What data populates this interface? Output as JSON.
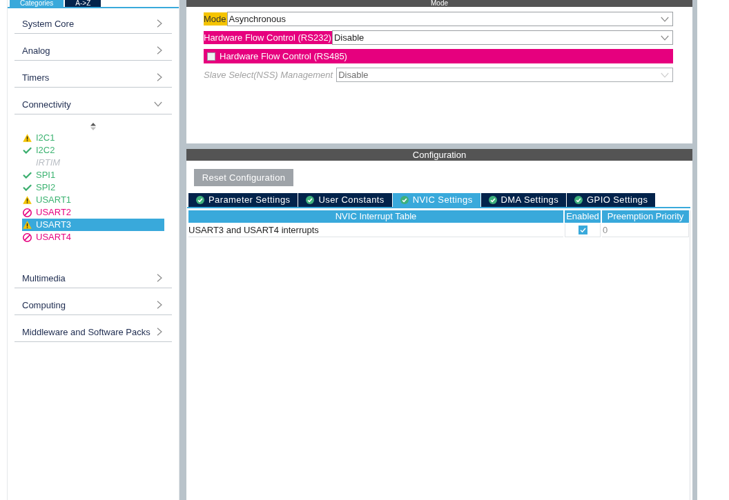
{
  "sidebar": {
    "tabs": [
      {
        "label": "Categories",
        "selected": true
      },
      {
        "label": "A->Z",
        "selected": false
      }
    ],
    "categories": [
      {
        "label": "System Core",
        "expanded": false
      },
      {
        "label": "Analog",
        "expanded": false
      },
      {
        "label": "Timers",
        "expanded": false
      },
      {
        "label": "Connectivity",
        "expanded": true,
        "children": [
          {
            "label": "I2C1",
            "kind": "warning",
            "selected": false
          },
          {
            "label": "I2C2",
            "kind": "ok",
            "selected": false
          },
          {
            "label": "IRTIM",
            "kind": "disabled",
            "selected": false
          },
          {
            "label": "SPI1",
            "kind": "ok",
            "selected": false
          },
          {
            "label": "SPI2",
            "kind": "ok",
            "selected": false
          },
          {
            "label": "USART1",
            "kind": "warning",
            "selected": false
          },
          {
            "label": "USART2",
            "kind": "error",
            "selected": false
          },
          {
            "label": "USART3",
            "kind": "warning",
            "selected": true
          },
          {
            "label": "USART4",
            "kind": "error",
            "selected": false
          }
        ]
      },
      {
        "label": "Multimedia",
        "expanded": false
      },
      {
        "label": "Computing",
        "expanded": false
      },
      {
        "label": "Middleware and Software Packs",
        "expanded": false
      }
    ]
  },
  "mode_panel": {
    "title": "Mode",
    "fields": [
      {
        "kind": "select",
        "label": "Mode",
        "value": "Asynchronous",
        "color": "#f5c400",
        "disabled": false
      },
      {
        "kind": "select",
        "label": "Hardware Flow Control (RS232)",
        "value": "Disable",
        "color": "#e6007e",
        "disabled": false
      },
      {
        "kind": "checkbox",
        "label": "Hardware Flow Control (RS485)",
        "checked": false,
        "color": "#e6007e",
        "disabled": false
      },
      {
        "kind": "select",
        "label": "Slave Select(NSS) Management",
        "value": "Disable",
        "disabled": true
      }
    ]
  },
  "configuration_panel": {
    "title": "Configuration",
    "reset_button": "Reset Configuration",
    "tabs": [
      {
        "label": "Parameter Settings",
        "selected": false
      },
      {
        "label": "User Constants",
        "selected": false
      },
      {
        "label": "NVIC Settings",
        "selected": true
      },
      {
        "label": "DMA Settings",
        "selected": false
      },
      {
        "label": "GPIO Settings",
        "selected": false
      }
    ],
    "table": {
      "columns": [
        "NVIC Interrupt Table",
        "Enabled",
        "Preemption Priority"
      ],
      "rows": [
        {
          "name": "USART3 and USART4 interrupts",
          "enabled": true,
          "priority": "0"
        }
      ]
    }
  }
}
